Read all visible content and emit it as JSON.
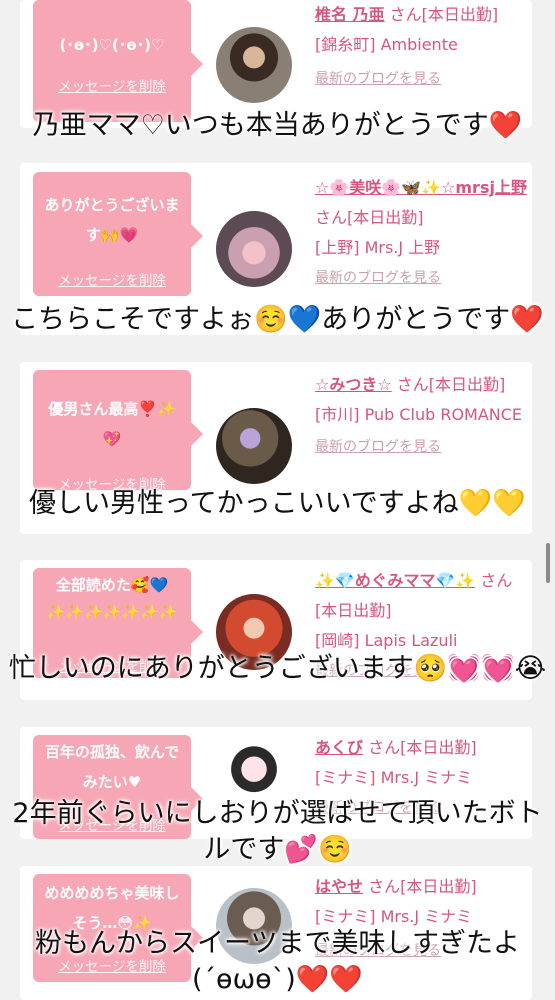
{
  "common": {
    "delete_label": "メッセージを削除",
    "blog_label": "最新のブログを見る",
    "on_duty_suffix": "さん[本日出勤]"
  },
  "cards": [
    {
      "message": "(･ө･)♡(･ө･)♡",
      "name": "椎名 乃亜",
      "shop": "[錦糸町] Ambiente",
      "caption": "乃亜ママ♡いつも本当ありがとうです❤️"
    },
    {
      "message": "ありがとうございます🙌💗",
      "name": "☆🌸美咲🌸🦋✨☆mrsj上野",
      "shop": "[上野] Mrs.J 上野",
      "caption": "こちらこそですよぉ☺️💙ありがとうです❤️"
    },
    {
      "message": "優男さん最高❣️✨💖",
      "name": "☆みつき☆",
      "shop": "[市川] Pub Club ROMANCE",
      "caption": "優しい男性ってかっこいいですよね💛💛"
    },
    {
      "message": "全部読めた🥰💙✨✨✨✨✨✨✨",
      "name": "✨💎めぐみママ💎✨",
      "shop": "[岡崎] Lapis Lazuli",
      "caption": "忙しいのにありがとうございます🥺💓💓😭"
    },
    {
      "message": "百年の孤独、飲んでみたい♥",
      "name": "あくび",
      "shop": "[ミナミ] Mrs.J ミナミ",
      "caption": "2年前ぐらいにしおりが選ばせて頂いたボトルです💕☺️"
    },
    {
      "message": "めめめめちゃ美味しそう…😳✨",
      "name": "はやせ",
      "shop": "[ミナミ] Mrs.J ミナミ",
      "caption": "粉もんからスイーツまで美味しすぎたよ(´ѳωѳ`)❤️❤️"
    }
  ]
}
